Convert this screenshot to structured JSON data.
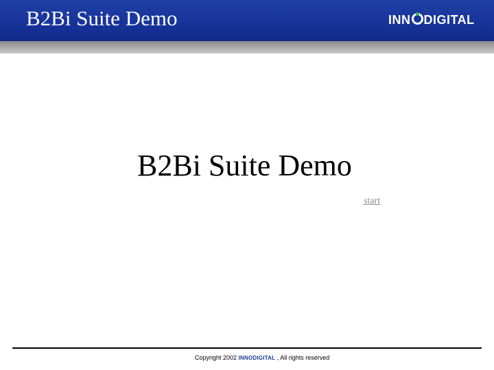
{
  "header": {
    "title": "B2Bi Suite Demo",
    "logo_text": {
      "left": "INN",
      "right": "DIGITAL"
    }
  },
  "main": {
    "title": "B2Bi Suite Demo",
    "start_link": "start"
  },
  "footer": {
    "copyright_prefix": "Copyright 2002",
    "logo_text": "INNODIGITAL",
    "copyright_suffix": ", All rights reserved"
  },
  "colors": {
    "header_blue": "#1f3fa5",
    "logo_green": "#46b54c",
    "link_gray": "#8c8c8c"
  }
}
